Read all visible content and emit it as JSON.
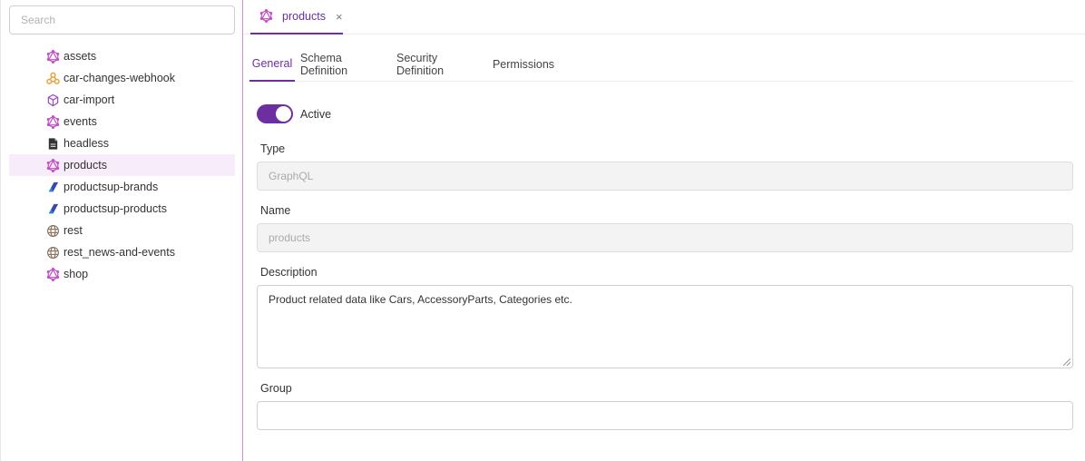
{
  "sidebar": {
    "search_placeholder": "Search",
    "items": [
      {
        "label": "assets",
        "icon": "graphql-icon"
      },
      {
        "label": "car-changes-webhook",
        "icon": "webhook-icon"
      },
      {
        "label": "car-import",
        "icon": "import-icon"
      },
      {
        "label": "events",
        "icon": "graphql-icon"
      },
      {
        "label": "headless",
        "icon": "file-icon"
      },
      {
        "label": "products",
        "icon": "graphql-icon"
      },
      {
        "label": "productsup-brands",
        "icon": "productsup-icon"
      },
      {
        "label": "productsup-products",
        "icon": "productsup-icon"
      },
      {
        "label": "rest",
        "icon": "globe-icon"
      },
      {
        "label": "rest_news-and-events",
        "icon": "globe-icon"
      },
      {
        "label": "shop",
        "icon": "graphql-icon"
      }
    ],
    "selected_index": 5
  },
  "tab": {
    "label": "products",
    "close_glyph": "×"
  },
  "subtabs": [
    "General",
    "Schema Definition",
    "Security Definition",
    "Permissions"
  ],
  "form": {
    "active_label": "Active",
    "active": true,
    "type_label": "Type",
    "type_value": "GraphQL",
    "name_label": "Name",
    "name_value": "products",
    "description_label": "Description",
    "description_value": "Product related data like Cars, AccessoryParts, Categories etc.",
    "group_label": "Group",
    "group_value": ""
  },
  "colors": {
    "accent": "#6d2fa0",
    "graphql": "#c24fc5",
    "productsup": "#3949ab",
    "webhook": "#e8a33d",
    "selected_bg": "#f7ecfa"
  }
}
